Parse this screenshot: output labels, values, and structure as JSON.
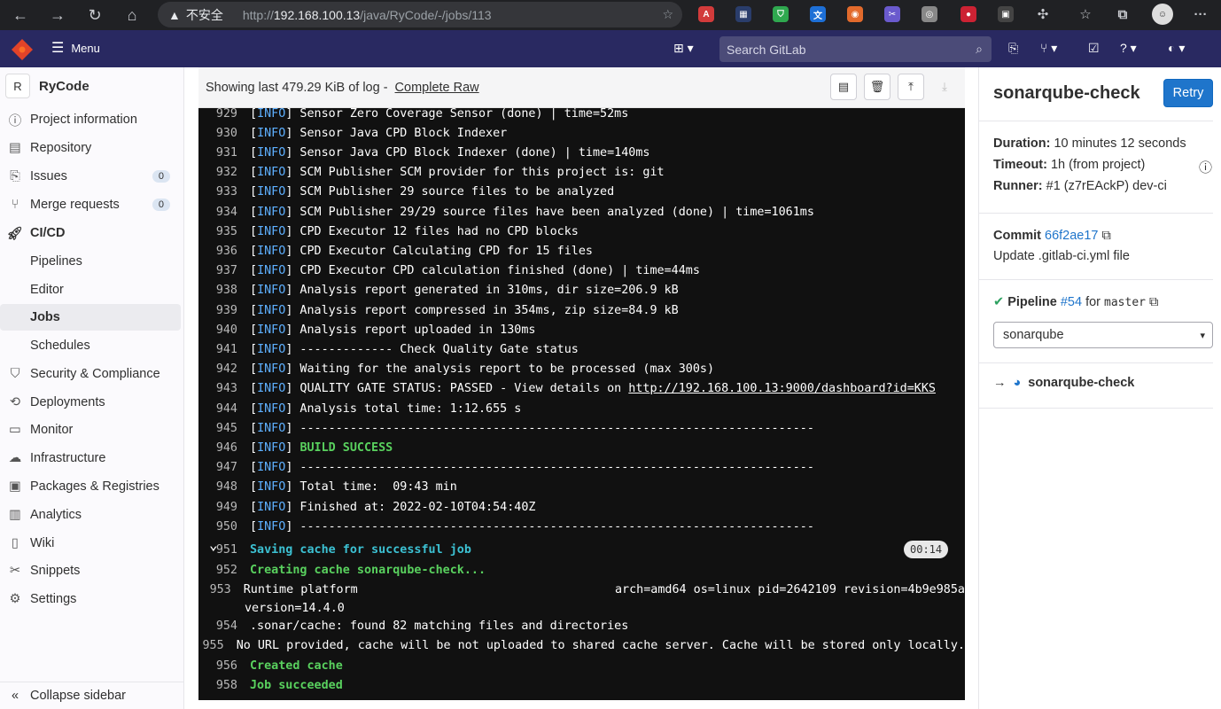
{
  "browser": {
    "insecure_label": "不安全",
    "url_prefix": "http://",
    "url_host": "192.168.100.13",
    "url_path": "/java/RyCode/-/jobs/113"
  },
  "header": {
    "menu_label": "Menu",
    "search_placeholder": "Search GitLab"
  },
  "sidebar": {
    "project_initial": "R",
    "project_name": "RyCode",
    "items": [
      {
        "label": "Project information"
      },
      {
        "label": "Repository"
      },
      {
        "label": "Issues",
        "badge": "0"
      },
      {
        "label": "Merge requests",
        "badge": "0"
      },
      {
        "label": "CI/CD"
      },
      {
        "label": "Pipelines"
      },
      {
        "label": "Editor"
      },
      {
        "label": "Jobs"
      },
      {
        "label": "Schedules"
      },
      {
        "label": "Security & Compliance"
      },
      {
        "label": "Deployments"
      },
      {
        "label": "Monitor"
      },
      {
        "label": "Infrastructure"
      },
      {
        "label": "Packages & Registries"
      },
      {
        "label": "Analytics"
      },
      {
        "label": "Wiki"
      },
      {
        "label": "Snippets"
      },
      {
        "label": "Settings"
      }
    ],
    "collapse_label": "Collapse sidebar"
  },
  "log_header": {
    "showing": "Showing last 479.29 KiB of log -",
    "complete_raw": "Complete Raw"
  },
  "log": {
    "lines": [
      {
        "n": "929",
        "tag": "INFO",
        "text": " Sensor Zero Coverage Sensor (done) | time=52ms"
      },
      {
        "n": "930",
        "tag": "INFO",
        "text": " Sensor Java CPD Block Indexer"
      },
      {
        "n": "931",
        "tag": "INFO",
        "text": " Sensor Java CPD Block Indexer (done) | time=140ms"
      },
      {
        "n": "932",
        "tag": "INFO",
        "text": " SCM Publisher SCM provider for this project is: git"
      },
      {
        "n": "933",
        "tag": "INFO",
        "text": " SCM Publisher 29 source files to be analyzed"
      },
      {
        "n": "934",
        "tag": "INFO",
        "text": " SCM Publisher 29/29 source files have been analyzed (done) | time=1061ms"
      },
      {
        "n": "935",
        "tag": "INFO",
        "text": " CPD Executor 12 files had no CPD blocks"
      },
      {
        "n": "936",
        "tag": "INFO",
        "text": " CPD Executor Calculating CPD for 15 files"
      },
      {
        "n": "937",
        "tag": "INFO",
        "text": " CPD Executor CPD calculation finished (done) | time=44ms"
      },
      {
        "n": "938",
        "tag": "INFO",
        "text": " Analysis report generated in 310ms, dir size=206.9 kB"
      },
      {
        "n": "939",
        "tag": "INFO",
        "text": " Analysis report compressed in 354ms, zip size=84.9 kB"
      },
      {
        "n": "940",
        "tag": "INFO",
        "text": " Analysis report uploaded in 130ms"
      },
      {
        "n": "941",
        "tag": "INFO",
        "text": " ------------- Check Quality Gate status"
      },
      {
        "n": "942",
        "tag": "INFO",
        "text": " Waiting for the analysis report to be processed (max 300s)"
      },
      {
        "n": "943",
        "tag": "INFO",
        "text": " QUALITY GATE STATUS: PASSED - View details on ",
        "url": "http://192.168.100.13:9000/dashboard?id=KKS"
      },
      {
        "n": "944",
        "tag": "INFO",
        "text": " Analysis total time: 1:12.655 s"
      },
      {
        "n": "945",
        "tag": "INFO",
        "text": " ------------------------------------------------------------------------"
      },
      {
        "n": "946",
        "tag": "INFO",
        "text": " ",
        "green": "BUILD SUCCESS"
      },
      {
        "n": "947",
        "tag": "INFO",
        "text": " ------------------------------------------------------------------------"
      },
      {
        "n": "948",
        "tag": "INFO",
        "text": " Total time:  09:43 min"
      },
      {
        "n": "949",
        "tag": "INFO",
        "text": " Finished at: 2022-02-10T04:54:40Z"
      },
      {
        "n": "950",
        "tag": "INFO",
        "text": " ------------------------------------------------------------------------"
      }
    ],
    "section_line": {
      "n": "951",
      "text": "Saving cache for successful job",
      "duration": "00:14"
    },
    "after": [
      {
        "n": "952",
        "text": "Creating cache sonarqube-check...",
        "style": "green"
      },
      {
        "n": "953",
        "text": "Runtime platform                                    arch=amd64 os=linux pid=2642109 revision=4b9e985a",
        "style": "plain"
      },
      {
        "n": "",
        "text": "version=14.4.0",
        "style": "plain"
      },
      {
        "n": "954",
        "text": ".sonar/cache: found 82 matching files and directories",
        "style": "plain"
      },
      {
        "n": "955",
        "text": "No URL provided, cache will be not uploaded to shared cache server. Cache will be stored only locally.",
        "style": "plain"
      },
      {
        "n": "956",
        "text": "Created cache",
        "style": "green"
      },
      {
        "n": "958",
        "text": "Job succeeded",
        "style": "green"
      }
    ]
  },
  "job_panel": {
    "title": "sonarqube-check",
    "retry_label": "Retry",
    "duration_label": "Duration:",
    "duration_value": "10 minutes 12 seconds",
    "timeout_label": "Timeout:",
    "timeout_value": "1h (from project)",
    "runner_label": "Runner:",
    "runner_value": "#1 (z7rEAckP) dev-ci",
    "commit_label": "Commit",
    "commit_sha": "66f2ae17",
    "commit_message": "Update .gitlab-ci.yml file",
    "pipeline_label": "Pipeline",
    "pipeline_id": "#54",
    "pipeline_for": "for",
    "pipeline_branch": "master",
    "stage_selected": "sonarqube",
    "job_name": "sonarqube-check"
  },
  "colors": {
    "header_bg": "#292961",
    "retry_bg": "#1f75cb",
    "log_bg": "#111111",
    "info_tag": "#5eb0ff",
    "success_green": "#59d15e",
    "section_cyan": "#3cc1d3"
  }
}
